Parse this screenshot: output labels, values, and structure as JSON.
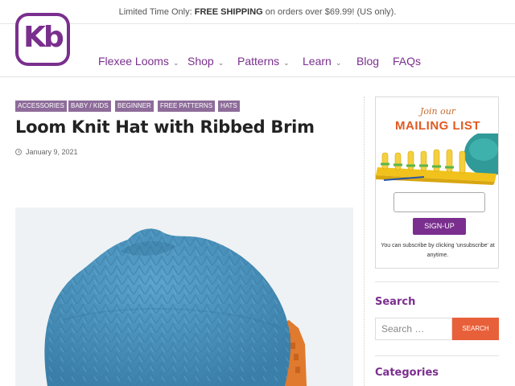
{
  "topbar": {
    "prefix": "Limited Time Only: ",
    "highlight": "FREE SHIPPING",
    "suffix": " on orders over $69.99! (US only)."
  },
  "logo": {
    "text": "Kb"
  },
  "nav": {
    "items": [
      {
        "label": "Flexee Looms",
        "has_dropdown": true
      },
      {
        "label": "Shop",
        "has_dropdown": true
      },
      {
        "label": "Patterns",
        "has_dropdown": true
      },
      {
        "label": "Learn",
        "has_dropdown": true
      },
      {
        "label": "Blog",
        "has_dropdown": false
      },
      {
        "label": "FAQs",
        "has_dropdown": false
      }
    ],
    "dropdown_glyph": "⌄"
  },
  "post": {
    "categories": [
      "ACCESSORIES",
      "BABY / KIDS",
      "BEGINNER",
      "FREE PATTERNS",
      "HATS"
    ],
    "title": "Loom Knit Hat with Ribbed Brim",
    "date": "January 9, 2021"
  },
  "sidebar": {
    "mailing": {
      "join": "Join our",
      "title": "MAILING LIST",
      "email_value": "",
      "button": "SIGN-UP",
      "note_line1": "You can subscribe by clicking 'unsubscribe' at",
      "note_line2": "anytime."
    },
    "search": {
      "title": "Search",
      "placeholder": "Search …",
      "button": "SEARCH"
    },
    "categories": {
      "title": "Categories"
    }
  },
  "colors": {
    "brand_purple": "#7a2f8e",
    "category_tag": "#8e6c9a",
    "accent_orange": "#e05a22",
    "search_button": "#e8603a",
    "hat_blue": "#4a93bc"
  }
}
